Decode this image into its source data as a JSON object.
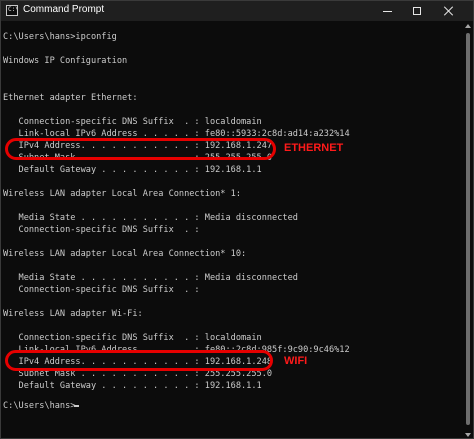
{
  "window": {
    "title": "Command Prompt",
    "icon_text": "C:\\",
    "icon": "terminal-icon"
  },
  "console": {
    "lines": [
      "C:\\Users\\hans>ipconfig",
      "",
      "Windows IP Configuration",
      "",
      "",
      "Ethernet adapter Ethernet:",
      "",
      "   Connection-specific DNS Suffix  . : localdomain",
      "   Link-local IPv6 Address . . . . . : fe80::5933:2c8d:ad14:a232%14",
      "   IPv4 Address. . . . . . . . . . . : 192.168.1.247",
      "   Subnet Mask . . . . . . . . . . . : 255.255.255.0",
      "   Default Gateway . . . . . . . . . : 192.168.1.1",
      "",
      "Wireless LAN adapter Local Area Connection* 1:",
      "",
      "   Media State . . . . . . . . . . . : Media disconnected",
      "   Connection-specific DNS Suffix  . :",
      "",
      "Wireless LAN adapter Local Area Connection* 10:",
      "",
      "   Media State . . . . . . . . . . . : Media disconnected",
      "   Connection-specific DNS Suffix  . :",
      "",
      "Wireless LAN adapter Wi-Fi:",
      "",
      "   Connection-specific DNS Suffix  . : localdomain",
      "   Link-local IPv6 Address . . . . . : fe80::2c8d:985f:9c90:9c46%12",
      "   IPv4 Address. . . . . . . . . . . : 192.168.1.248",
      "   Subnet Mask . . . . . . . . . . . : 255.255.255.0",
      "   Default Gateway . . . . . . . . . : 192.168.1.1",
      "",
      "C:\\Users\\hans>"
    ]
  },
  "annotations": {
    "ethernet_label": "ETHERNET",
    "wifi_label": "WIFI",
    "color": "#e60000"
  },
  "theme": {
    "background": "#0c0c0c",
    "text": "#cccccc",
    "titlebar": "#1f1f1f"
  }
}
